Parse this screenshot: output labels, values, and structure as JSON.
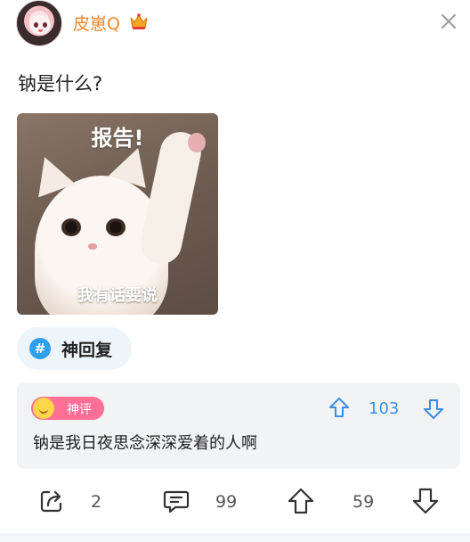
{
  "header": {
    "username": "皮崽Q",
    "avatar_icon": "anime-girl-avatar",
    "crown_icon": "crown-icon",
    "close_icon": "close-icon",
    "username_color": "#f0862b"
  },
  "post": {
    "question": "钠是什么?",
    "meme": {
      "caption_top": "报告!",
      "caption_bottom": "我有话要说"
    },
    "topic": {
      "icon": "hash-icon",
      "label": "神回复"
    }
  },
  "top_comment": {
    "badge_label": "神评",
    "upvotes": "103",
    "text": "钠是我日夜思念深深爱着的人啊",
    "accent_color": "#3b8ee4"
  },
  "actions": {
    "share_count": "2",
    "comment_count": "99",
    "upvote_count": "59"
  }
}
